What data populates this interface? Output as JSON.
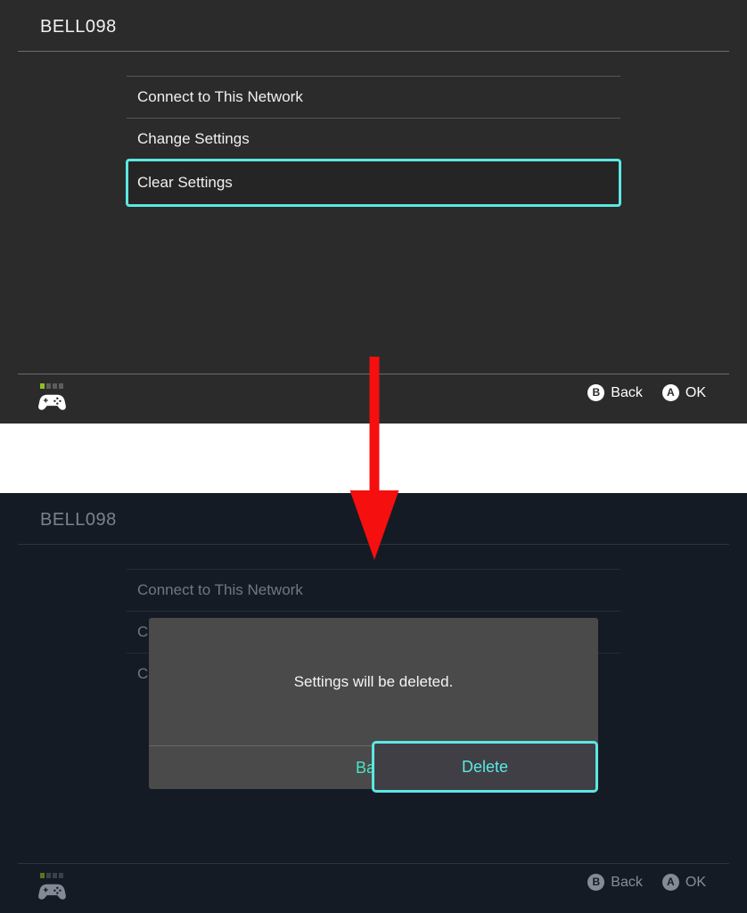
{
  "screen_top": {
    "header": {
      "title": "BELL098"
    },
    "menu": [
      {
        "label": "Connect to This Network",
        "selected": false
      },
      {
        "label": "Change Settings",
        "selected": false
      },
      {
        "label": "Clear Settings",
        "selected": true
      }
    ],
    "footer": {
      "controller_icon": "gamepad-icon",
      "player_slots": [
        true,
        false,
        false,
        false
      ],
      "hints": [
        {
          "button": "B",
          "label": "Back"
        },
        {
          "button": "A",
          "label": "OK"
        }
      ]
    }
  },
  "screen_bottom": {
    "header": {
      "title": "BELL098"
    },
    "menu": [
      {
        "label": "Connect to This Network",
        "selected": false
      },
      {
        "label": "Change Settings",
        "selected": false
      },
      {
        "label": "Clear Settings",
        "selected": false
      }
    ],
    "dialog": {
      "message": "Settings will be deleted.",
      "buttons": [
        {
          "label": "Back",
          "selected": false
        },
        {
          "label": "Delete",
          "selected": true
        }
      ]
    },
    "footer": {
      "controller_icon": "gamepad-icon",
      "player_slots": [
        true,
        false,
        false,
        false
      ],
      "hints": [
        {
          "button": "B",
          "label": "Back"
        },
        {
          "button": "A",
          "label": "OK"
        }
      ]
    }
  },
  "annotation": {
    "arrow_icon": "down-arrow-annotation",
    "color": "#f50f0f"
  },
  "colors": {
    "panel_top_bg": "#2b2b2b",
    "panel_bottom_bg": "#151b24",
    "divider_band": "#ffffff",
    "highlight_cyan": "#5ce7e2",
    "dialog_bg": "#4a4a4a",
    "dialog_button_text": "#48e3c6",
    "player_active": "#8ec11e",
    "arrow_red": "#f50f0f"
  }
}
